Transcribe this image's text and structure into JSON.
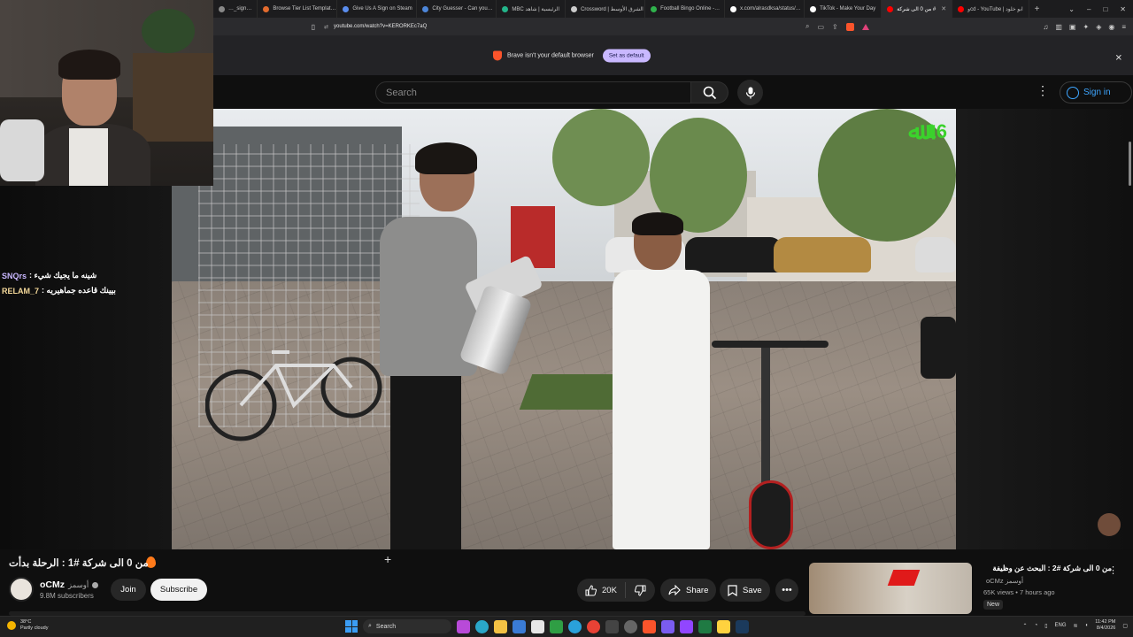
{
  "browser": {
    "tabs": [
      {
        "label": "…_sign…",
        "color": "#888888",
        "active": false
      },
      {
        "label": "Browse Tier List Templat…",
        "color": "#e26b2e",
        "active": false
      },
      {
        "label": "Give Us A Sign on Steam",
        "color": "#5a8dee",
        "active": false
      },
      {
        "label": "City Guesser - Can you…",
        "color": "#4d86d9",
        "active": false
      },
      {
        "label": "MBC الرئيسية | شاهد",
        "color": "#23b58a",
        "active": false
      },
      {
        "label": "Crossword | الشرق الأوسط",
        "color": "#cccccc",
        "active": false
      },
      {
        "label": "Football Bingo Online -…",
        "color": "#2fb24c",
        "active": false
      },
      {
        "label": "x.com/alrasdksa/status/…",
        "color": "#ffffff",
        "active": false
      },
      {
        "label": "TikTok - Make Your Day",
        "color": "#ffffff",
        "active": false
      },
      {
        "label": "من 0 الى شركة #",
        "color": "#ff0000",
        "active": true
      },
      {
        "label": "وcd - YouTube | ابو خلود",
        "color": "#ff0000",
        "active": false
      }
    ],
    "new_tab": "+",
    "url": "youtube.com/watch?v=KERORKEc7aQ",
    "default_bar": {
      "message": "Brave isn't your default browser",
      "button": "Set as default"
    }
  },
  "youtube": {
    "search_placeholder": "Search",
    "signin_label": "Sign in",
    "video_title": "من 0 الى شركة #1 : الرحلة بدأت",
    "watermark": "16",
    "channel": {
      "name": "oCMz",
      "alt_name": "أوسمز",
      "subscribers": "9.8M subscribers"
    },
    "buttons": {
      "join": "Join",
      "subscribe": "Subscribe",
      "likes": "20K",
      "share": "Share",
      "save": "Save"
    },
    "recommendation": {
      "title": "من 0 الى شركة #2 : البحث عن وظيفة",
      "channel": "oCMz أوسمز",
      "meta": "65K views • 7 hours ago",
      "badge": "New"
    }
  },
  "stream_chat": [
    {
      "user": "SNQrs",
      "message": ": شينه ما يجيك شيء"
    },
    {
      "user": "RELAM_7",
      "message": ": بيينك قاعده جماهيريه"
    }
  ],
  "taskbar": {
    "temperature": "38°C",
    "weather": "Partly cloudy",
    "search": "Search",
    "lang": "ENG",
    "time": "11:42 PM",
    "date": "8/4/2026"
  }
}
